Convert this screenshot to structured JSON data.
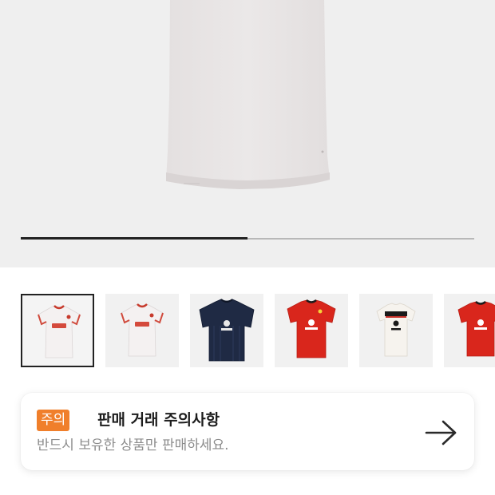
{
  "product_gallery": {
    "current_image": "white-shirt-back",
    "scroll_progress": 0.5
  },
  "thumbnails": [
    {
      "name": "white-third-kit-front",
      "selected": true
    },
    {
      "name": "white-third-kit-front-alt",
      "selected": false
    },
    {
      "name": "navy-training-shirt",
      "selected": false
    },
    {
      "name": "red-home-kit",
      "selected": false
    },
    {
      "name": "white-away-kit",
      "selected": false
    },
    {
      "name": "red-home-kit-partial",
      "selected": false
    }
  ],
  "notice": {
    "badge": "주의",
    "title": "판매 거래 주의사항",
    "subtitle": "반드시 보유한 상품만 판매하세요.",
    "arrow_icon": "arrow-right-icon"
  },
  "colors": {
    "badge": "#f07f2b",
    "hero_background": "#efefef",
    "thumb_background": "#f1f1f1"
  }
}
